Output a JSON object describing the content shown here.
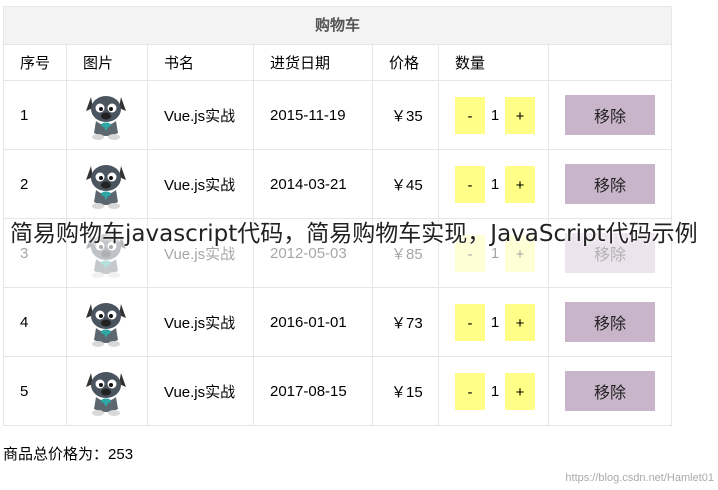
{
  "cart": {
    "title": "购物车",
    "headers": [
      "序号",
      "图片",
      "书名",
      "进货日期",
      "价格",
      "数量",
      ""
    ],
    "rows": [
      {
        "index": "1",
        "name": "Vue.js实战",
        "date": "2015-11-19",
        "price": "￥35",
        "qty": "1",
        "minus": "-",
        "plus": "+",
        "remove": "移除"
      },
      {
        "index": "2",
        "name": "Vue.js实战",
        "date": "2014-03-21",
        "price": "￥45",
        "qty": "1",
        "minus": "-",
        "plus": "+",
        "remove": "移除"
      },
      {
        "index": "3",
        "name": "Vue.js实战",
        "date": "2012-05-03",
        "price": "￥85",
        "qty": "1",
        "minus": "-",
        "plus": "+",
        "remove": "移除"
      },
      {
        "index": "4",
        "name": "Vue.js实战",
        "date": "2016-01-01",
        "price": "￥73",
        "qty": "1",
        "minus": "-",
        "plus": "+",
        "remove": "移除"
      },
      {
        "index": "5",
        "name": "Vue.js实战",
        "date": "2017-08-15",
        "price": "￥15",
        "qty": "1",
        "minus": "-",
        "plus": "+",
        "remove": "移除"
      }
    ]
  },
  "total": {
    "label": "商品总价格为：",
    "value": "253"
  },
  "overlay_text": "简易购物车javascript代码，简易购物车实现，JavaScript代码示例",
  "watermark": "https://blog.csdn.net/Hamlet01",
  "icons": {
    "thumbnail": "cartoon-dog-icon"
  },
  "colors": {
    "qty_button": "#ffff88",
    "remove_button": "#c9b5c9",
    "caption_bg": "#f3f3f3"
  }
}
